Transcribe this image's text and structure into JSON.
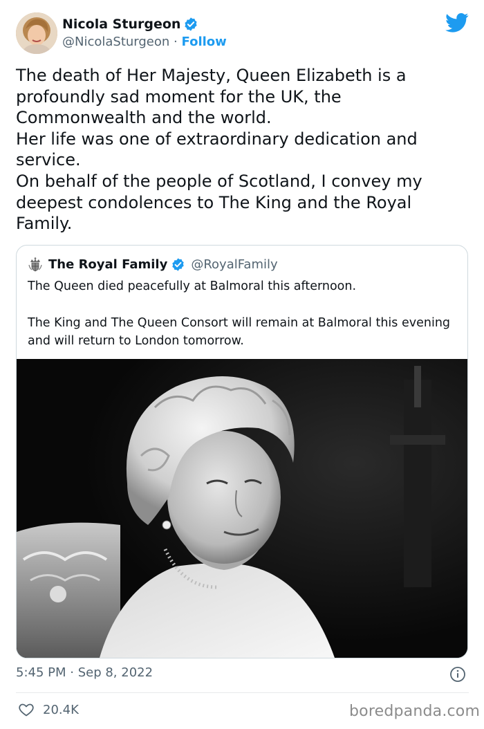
{
  "author": {
    "name": "Nicola Sturgeon",
    "handle": "@NicolaSturgeon",
    "separator": "·",
    "follow_label": "Follow",
    "verified_icon": "verified-badge-icon",
    "platform_icon": "twitter-bird-icon"
  },
  "tweet": {
    "lines": [
      "The death of Her Majesty, Queen Elizabeth is a profoundly sad moment for the UK, the Commonwealth and the world.",
      "Her life was one of extraordinary dedication and service.",
      "On behalf of the people of Scotland, I convey my deepest condolences to The King and the Royal Family."
    ]
  },
  "quoted": {
    "name": "The Royal Family",
    "handle": "@RoyalFamily",
    "paragraphs": [
      "The Queen died peacefully at Balmoral this afternoon.",
      "The King and The Queen Consort will remain at Balmoral this evening and will return to London tomorrow."
    ],
    "photo_icon": "black-and-white-portrait-photo"
  },
  "footer": {
    "timestamp": "5:45 PM · Sep 8, 2022",
    "like_count": "20.4K",
    "watermark": "boredpanda.com"
  },
  "colors": {
    "accent": "#1d9bf0",
    "text_primary": "#0f1419",
    "text_secondary": "#536471",
    "border": "#cfd9de"
  }
}
